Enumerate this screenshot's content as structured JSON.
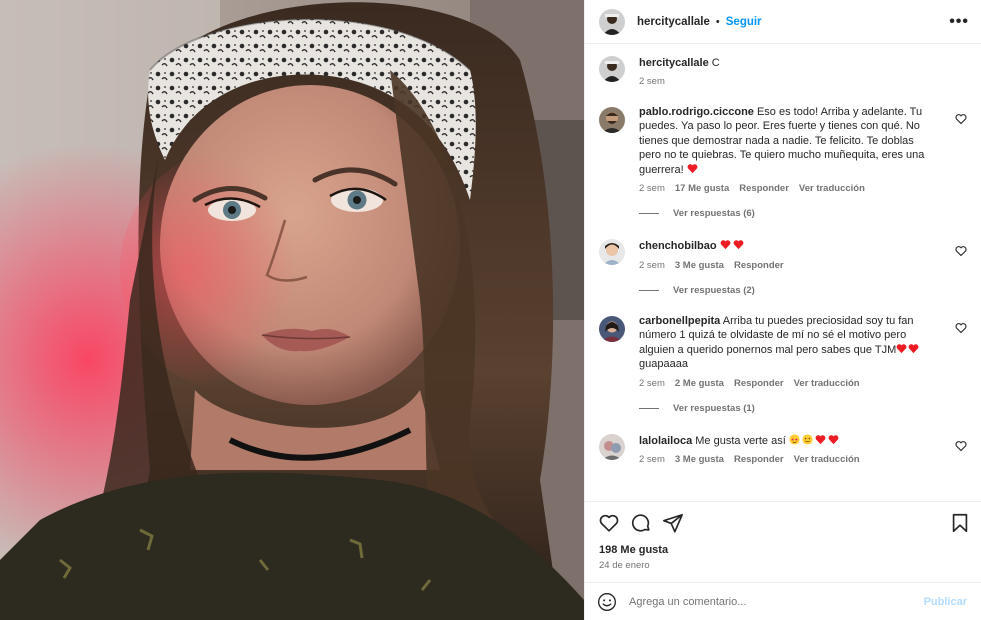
{
  "post": {
    "author": "hercitycallale",
    "follow_label": "Seguir",
    "separator": "•",
    "more_label": "•••"
  },
  "caption": {
    "author": "hercitycallale",
    "text": "C",
    "time": "2 sem"
  },
  "comments": [
    {
      "author": "pablo.rodrigo.ciccone",
      "text_lines": [
        "Eso es todo! Arriba y adelante. Tu",
        "puedes. Ya paso lo peor. Eres fuerte y tienes con qué. No",
        "tienes que demostrar nada a nadie. Te felicito. Te doblas",
        "pero no te quiebras. Te quiero mucho muñequita, eres una",
        "guerrera!"
      ],
      "time": "2 sem",
      "likes": "17 Me gusta",
      "reply": "Responder",
      "translate": "Ver traducción",
      "view_replies": "Ver respuestas (6)"
    },
    {
      "author": "chenchobilbao",
      "time": "2 sem",
      "likes": "3 Me gusta",
      "reply": "Responder",
      "view_replies": "Ver respuestas (2)"
    },
    {
      "author": "carbonellpepita",
      "text_lines": [
        "Arriba tu puedes preciosidad soy tu fan",
        "número 1 quizá te olvidaste de mí no sé el motivo pero",
        "alguien a querido ponernos mal pero sabes que TJM"
      ],
      "text_end": "guapaaaa",
      "time": "2 sem",
      "likes": "2 Me gusta",
      "reply": "Responder",
      "translate": "Ver traducción",
      "view_replies": "Ver respuestas (1)"
    },
    {
      "author": "lalolailoca",
      "text": "Me gusta verte así",
      "time": "2 sem",
      "likes": "3 Me gusta",
      "reply": "Responder",
      "translate": "Ver traducción"
    }
  ],
  "footer": {
    "likes": "198 Me gusta",
    "date": "24 de enero",
    "comment_placeholder": "Agrega un comentario...",
    "post_label": "Publicar"
  },
  "colors": {
    "accent": "#0095f6",
    "heart": "#ed1c24",
    "muted": "#737373"
  }
}
